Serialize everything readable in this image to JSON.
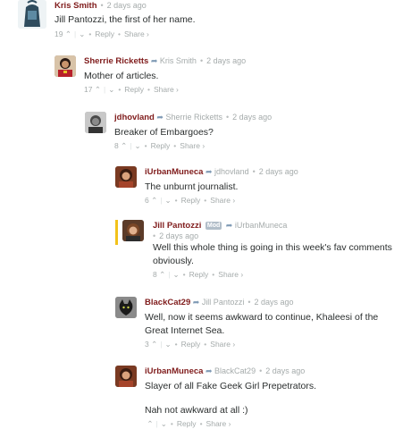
{
  "colors": {
    "author": "#7f1b1b",
    "muted": "#a5abab",
    "highlight": "#f2c21a"
  },
  "comments": [
    {
      "author": "Kris Smith",
      "reply_to": "",
      "badge": "",
      "time": "2 days ago",
      "lines": [
        "Jill Pantozzi, the first of her name."
      ],
      "votes": "19",
      "reply": "Reply",
      "share": "Share ›"
    },
    {
      "author": "Sherrie Ricketts",
      "reply_to": "Kris Smith",
      "badge": "",
      "time": "2 days ago",
      "lines": [
        "Mother of articles."
      ],
      "votes": "17",
      "reply": "Reply",
      "share": "Share ›"
    },
    {
      "author": "jdhovland",
      "reply_to": "Sherrie Ricketts",
      "badge": "",
      "time": "2 days ago",
      "lines": [
        "Breaker of Embargoes?"
      ],
      "votes": "8",
      "reply": "Reply",
      "share": "Share ›"
    },
    {
      "author": "iUrbanMuneca",
      "reply_to": "jdhovland",
      "badge": "",
      "time": "2 days ago",
      "lines": [
        "The unburnt journalist."
      ],
      "votes": "6",
      "reply": "Reply",
      "share": "Share ›"
    },
    {
      "author": "Jill Pantozzi",
      "reply_to": "iUrbanMuneca",
      "badge": "Mod",
      "time": "2 days ago",
      "lines": [
        "Well this whole thing is going in this week's fav comments obviously."
      ],
      "votes": "8",
      "reply": "Reply",
      "share": "Share ›"
    },
    {
      "author": "BlackCat29",
      "reply_to": "Jill Pantozzi",
      "badge": "",
      "time": "2 days ago",
      "lines": [
        "Well, now it seems awkward to continue, Khaleesi of the Great Internet Sea."
      ],
      "votes": "3",
      "reply": "Reply",
      "share": "Share ›"
    },
    {
      "author": "iUrbanMuneca",
      "reply_to": "BlackCat29",
      "badge": "",
      "time": "2 days ago",
      "lines": [
        "Slayer of all Fake Geek Girl Prepetrators.",
        "Nah not awkward at all :)"
      ],
      "votes": "",
      "reply": "Reply",
      "share": "Share ›"
    }
  ]
}
